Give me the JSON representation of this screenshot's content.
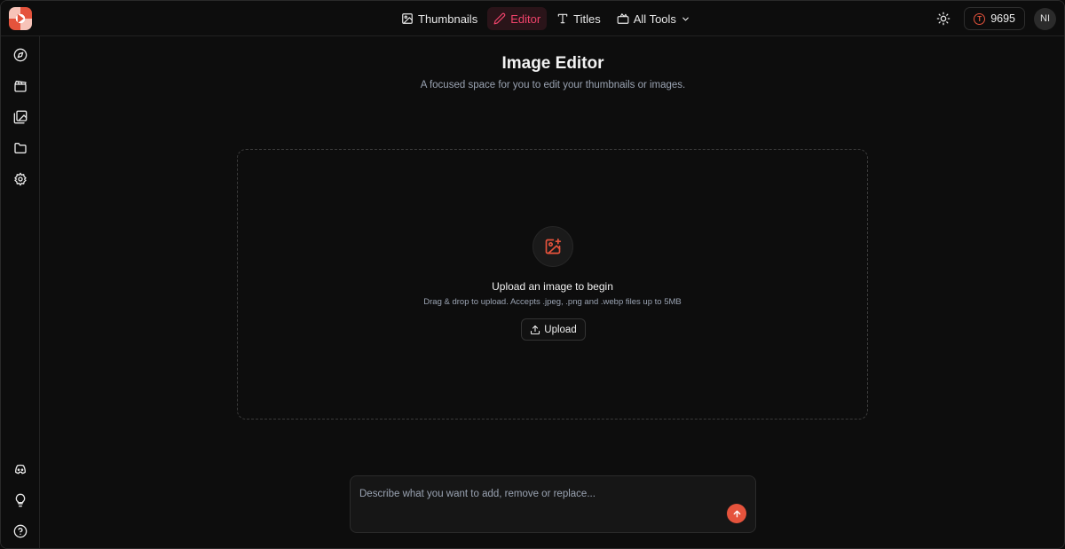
{
  "header": {
    "logo_icon": "app-logo-icon",
    "nav": [
      {
        "label": "Thumbnails",
        "icon": "image-icon",
        "active": false
      },
      {
        "label": "Editor",
        "icon": "pencil-icon",
        "active": true
      },
      {
        "label": "Titles",
        "icon": "text-icon",
        "active": false
      },
      {
        "label": "All Tools",
        "icon": "toolbox-icon",
        "active": false,
        "dropdown": true
      }
    ],
    "theme_icon": "sun-icon",
    "credits": "9695",
    "credit_icon_letter": "T",
    "avatar_initials": "NI"
  },
  "sidebar": {
    "top_items": [
      "compass-icon",
      "clapperboard-icon",
      "gallery-icon",
      "folder-icon",
      "gear-icon"
    ],
    "bottom_items": [
      "discord-icon",
      "lightbulb-icon",
      "help-icon"
    ]
  },
  "main": {
    "title": "Image Editor",
    "subtitle": "A focused space for you to edit your thumbnails or images.",
    "dropzone": {
      "icon": "image-plus-icon",
      "title": "Upload an image to begin",
      "description": "Drag & drop to upload. Accepts .jpeg, .png and .webp files up to 5MB",
      "upload_label": "Upload"
    },
    "prompt": {
      "placeholder": "Describe what you want to add, remove or replace...",
      "value": "",
      "send_icon": "arrow-up-icon"
    }
  },
  "colors": {
    "accent": "#e5533c",
    "active_nav": "#f0436b",
    "background": "#0d0d0d"
  }
}
